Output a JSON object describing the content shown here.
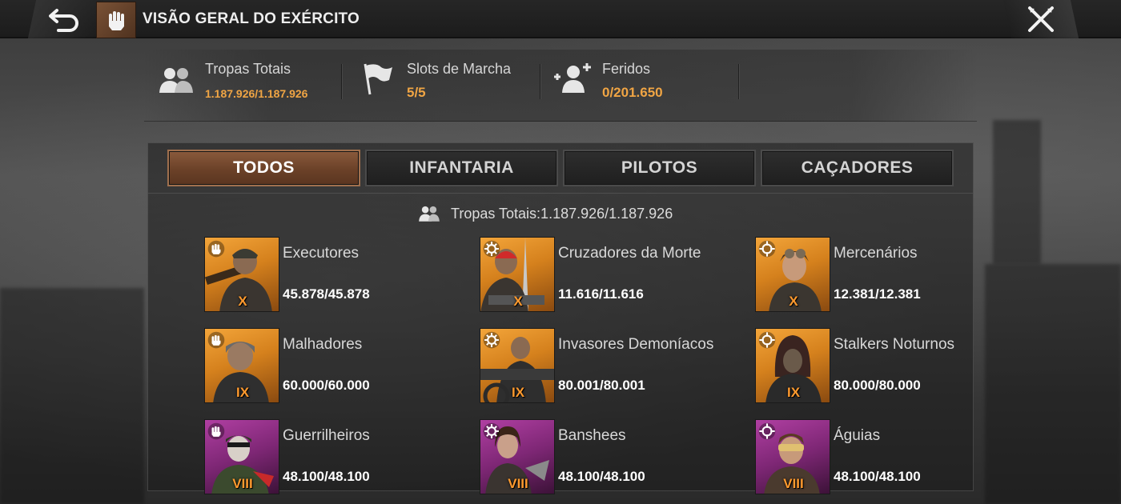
{
  "header": {
    "title": "VISÃO GERAL DO EXÉRCITO"
  },
  "stats": {
    "total_troops": {
      "label": "Tropas Totais",
      "value": "1.187.926/1.187.926"
    },
    "march_slots": {
      "label": "Slots de Marcha",
      "value": "5/5"
    },
    "wounded": {
      "label": "Feridos",
      "value": "0/201.650"
    }
  },
  "tabs": [
    {
      "label": "TODOS",
      "active": true
    },
    {
      "label": "INFANTARIA",
      "active": false
    },
    {
      "label": "PILOTOS",
      "active": false
    },
    {
      "label": "CAÇADORES",
      "active": false
    }
  ],
  "panel": {
    "totals_text": "Tropas Totais:1.187.926/1.187.926"
  },
  "units": [
    {
      "name": "Executores",
      "count": "45.878/45.878",
      "tier": "X",
      "type": "infantry",
      "color": "orange"
    },
    {
      "name": "Cruzadores da Morte",
      "count": "11.616/11.616",
      "tier": "X",
      "type": "rider",
      "color": "orange"
    },
    {
      "name": "Mercenários",
      "count": "12.381/12.381",
      "tier": "X",
      "type": "hunter",
      "color": "orange"
    },
    {
      "name": "Malhadores",
      "count": "60.000/60.000",
      "tier": "IX",
      "type": "infantry",
      "color": "orange"
    },
    {
      "name": "Invasores Demoníacos",
      "count": "80.001/80.001",
      "tier": "IX",
      "type": "rider",
      "color": "orange"
    },
    {
      "name": "Stalkers Noturnos",
      "count": "80.000/80.000",
      "tier": "IX",
      "type": "hunter",
      "color": "orange"
    },
    {
      "name": "Guerrilheiros",
      "count": "48.100/48.100",
      "tier": "VIII",
      "type": "infantry",
      "color": "purple"
    },
    {
      "name": "Banshees",
      "count": "48.100/48.100",
      "tier": "VIII",
      "type": "rider",
      "color": "purple"
    },
    {
      "name": "Águias",
      "count": "48.100/48.100",
      "tier": "VIII",
      "type": "hunter",
      "color": "purple"
    }
  ],
  "colors": {
    "accent_value": "#f0a544",
    "tab_active": "#7a4c30",
    "tier_text": "#ff9a2e"
  },
  "icons": {
    "back": "back-arrow-icon",
    "close": "close-x-icon",
    "title_badge": "fist-icon",
    "total_troops": "troops-icon",
    "march_slots": "flag-icon",
    "wounded": "wounded-icon",
    "infantry": "fist-icon",
    "rider": "gear-icon",
    "hunter": "crosshair-icon"
  }
}
